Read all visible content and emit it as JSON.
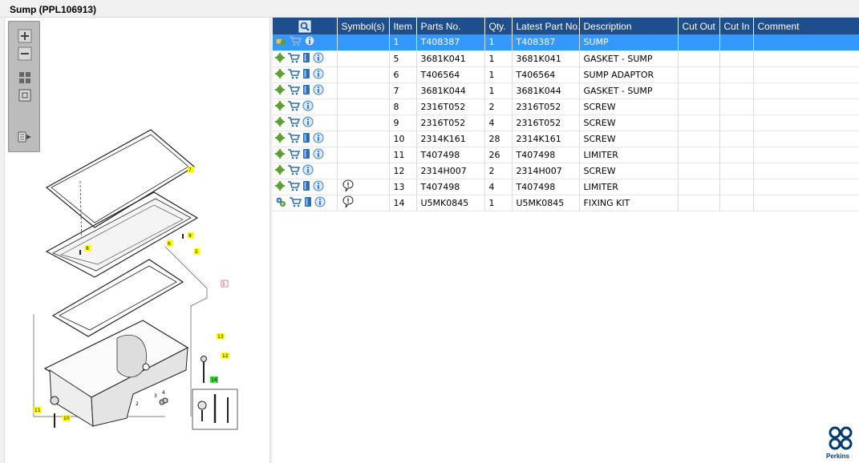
{
  "window": {
    "title": "Sump (PPL106913)"
  },
  "toolbar": {
    "tools": [
      {
        "name": "zoom-in-icon"
      },
      {
        "name": "zoom-out-icon"
      },
      {
        "name": "fit-all-icon"
      },
      {
        "name": "fit-window-icon"
      },
      {
        "name": "export-icon"
      }
    ]
  },
  "diagram": {
    "callouts": [
      "7",
      "8",
      "9",
      "6",
      "5",
      "1",
      "13",
      "12",
      "14",
      "4",
      "3",
      "2",
      "11",
      "10"
    ]
  },
  "grid": {
    "columns": [
      "Symbol(s)",
      "Item",
      "Parts No.",
      "Qty.",
      "Latest Part No.",
      "Description",
      "Cut Out",
      "Cut In",
      "Comment"
    ],
    "rows": [
      {
        "icons": [
          "assembly-icon",
          "cart-disabled-icon",
          "info-icon"
        ],
        "symbol": "",
        "item": "1",
        "part": "T408387",
        "qty": "1",
        "latest": "T408387",
        "desc": "SUMP",
        "cut_out": "",
        "cut_in": "",
        "comment": ""
      },
      {
        "icons": [
          "gear-icon",
          "cart-icon",
          "book-icon",
          "info-icon"
        ],
        "symbol": "",
        "item": "5",
        "part": "3681K041",
        "qty": "1",
        "latest": "3681K041",
        "desc": "GASKET - SUMP",
        "cut_out": "",
        "cut_in": "",
        "comment": ""
      },
      {
        "icons": [
          "gear-icon",
          "cart-icon",
          "book-icon",
          "info-icon"
        ],
        "symbol": "",
        "item": "6",
        "part": "T406564",
        "qty": "1",
        "latest": "T406564",
        "desc": "SUMP ADAPTOR",
        "cut_out": "",
        "cut_in": "",
        "comment": ""
      },
      {
        "icons": [
          "gear-icon",
          "cart-icon",
          "book-icon",
          "info-icon"
        ],
        "symbol": "",
        "item": "7",
        "part": "3681K044",
        "qty": "1",
        "latest": "3681K044",
        "desc": "GASKET - SUMP",
        "cut_out": "",
        "cut_in": "",
        "comment": ""
      },
      {
        "icons": [
          "gear-icon",
          "cart-icon",
          "info-icon"
        ],
        "symbol": "",
        "item": "8",
        "part": "2316T052",
        "qty": "2",
        "latest": "2316T052",
        "desc": "SCREW",
        "cut_out": "",
        "cut_in": "",
        "comment": ""
      },
      {
        "icons": [
          "gear-icon",
          "cart-icon",
          "info-icon"
        ],
        "symbol": "",
        "item": "9",
        "part": "2316T052",
        "qty": "4",
        "latest": "2316T052",
        "desc": "SCREW",
        "cut_out": "",
        "cut_in": "",
        "comment": ""
      },
      {
        "icons": [
          "gear-icon",
          "cart-icon",
          "book-icon",
          "info-icon"
        ],
        "symbol": "",
        "item": "10",
        "part": "2314K161",
        "qty": "28",
        "latest": "2314K161",
        "desc": "SCREW",
        "cut_out": "",
        "cut_in": "",
        "comment": ""
      },
      {
        "icons": [
          "gear-icon",
          "cart-icon",
          "book-icon",
          "info-icon"
        ],
        "symbol": "",
        "item": "11",
        "part": "T407498",
        "qty": "26",
        "latest": "T407498",
        "desc": "LIMITER",
        "cut_out": "",
        "cut_in": "",
        "comment": ""
      },
      {
        "icons": [
          "gear-icon",
          "cart-icon",
          "info-icon"
        ],
        "symbol": "",
        "item": "12",
        "part": "2314H007",
        "qty": "2",
        "latest": "2314H007",
        "desc": "SCREW",
        "cut_out": "",
        "cut_in": "",
        "comment": ""
      },
      {
        "icons": [
          "gear-icon",
          "cart-icon",
          "book-icon",
          "info-icon"
        ],
        "symbol": "note-icon",
        "item": "13",
        "part": "T407498",
        "qty": "4",
        "latest": "T407498",
        "desc": "LIMITER",
        "cut_out": "",
        "cut_in": "",
        "comment": ""
      },
      {
        "icons": [
          "kit-gear-icon",
          "cart-icon",
          "book-icon",
          "info-icon"
        ],
        "symbol": "note-icon",
        "item": "14",
        "part": "U5MK0845",
        "qty": "1",
        "latest": "U5MK0845",
        "desc": "FIXING KIT",
        "cut_out": "",
        "cut_in": "",
        "comment": ""
      }
    ]
  },
  "brand": {
    "name": "Perkins",
    "color": "#003b71"
  },
  "colors": {
    "header": "#1f4e8c",
    "selected": "#3399ff",
    "gear": "#5aa02c",
    "info": "#3a7fd5",
    "callout": "#ffff00",
    "callout_kit": "#3ddc3d"
  }
}
